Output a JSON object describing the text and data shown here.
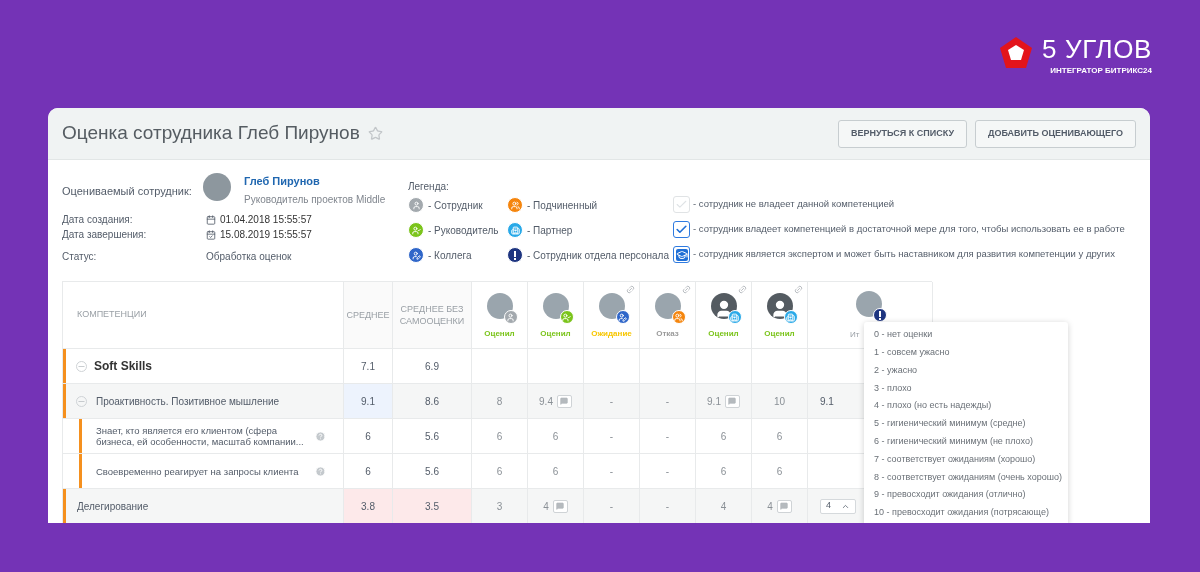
{
  "brand": {
    "name": "5 УГЛОВ",
    "tagline": "ИНТЕГРАТОР БИТРИКС24"
  },
  "header": {
    "title": "Оценка сотрудника Глеб Пирунов",
    "favorite": false,
    "buttons": [
      "ВЕРНУТЬСЯ К СПИСКУ",
      "ДОБАВИТЬ ОЦЕНИВАЮЩЕГО"
    ]
  },
  "info": {
    "employee_label": "Оцениваемый сотрудник:",
    "employee_name": "Глеб Пирунов",
    "employee_position": "Руководитель проектов Middle",
    "created_label": "Дата создания:",
    "created": "01.04.2018 15:55:57",
    "finished_label": "Дата завершения:",
    "finished": "15.08.2019 15:55:57",
    "status_label": "Статус:",
    "status": "Обработка оценок"
  },
  "legend": {
    "title": "Легенда:",
    "roles": [
      {
        "kind": "employee",
        "label": "- Сотрудник"
      },
      {
        "kind": "subordinate",
        "label": "- Подчиненный"
      },
      {
        "kind": "manager",
        "label": "- Руководитель"
      },
      {
        "kind": "partner",
        "label": "- Партнер"
      },
      {
        "kind": "colleague",
        "label": "- Коллега"
      },
      {
        "kind": "hr",
        "label": "- Сотрудник отдела персонала"
      }
    ],
    "levels": [
      {
        "kind": "none",
        "label": "- сотрудник не владеет данной компетенцией"
      },
      {
        "kind": "proficient",
        "label": "- сотрудник владеет компетенцией в достаточной мере для того, чтобы использовать ее в работе"
      },
      {
        "kind": "expert",
        "label": "- сотрудник является экспертом и может быть наставником для развития компетенции у других"
      }
    ]
  },
  "table": {
    "columns": [
      "КОМПЕТЕНЦИИ",
      "СРЕДНЕЕ",
      "СРЕДНЕЕ БЕЗ САМООЦЕНКИ"
    ],
    "evaluators": [
      {
        "kind": "employee",
        "photo": true,
        "link": false,
        "status": "Оценил",
        "color": "#7bc41b"
      },
      {
        "kind": "manager",
        "photo": true,
        "link": false,
        "status": "Оценил",
        "color": "#7bc41b"
      },
      {
        "kind": "colleague",
        "photo": true,
        "link": true,
        "status": "Ожидание",
        "color": "#f7c600"
      },
      {
        "kind": "subordinate",
        "photo": true,
        "link": true,
        "status": "Отказ",
        "color": "#9a9a9a"
      },
      {
        "kind": "partner",
        "photo": false,
        "link": true,
        "status": "Оценил",
        "color": "#7bc41b"
      },
      {
        "kind": "partner",
        "photo": false,
        "link": true,
        "status": "Оценил",
        "color": "#7bc41b"
      }
    ],
    "final_column": {
      "kind": "hr",
      "photo": true,
      "label": "Ит"
    },
    "rows": [
      {
        "kind": "group",
        "name": "Soft Skills",
        "expanded": true,
        "avg": {
          "value": "7.1"
        },
        "avg2": {
          "value": "6.9"
        },
        "scores": []
      },
      {
        "kind": "competence",
        "name": "Проактивность. Позитивное мышление",
        "expanded": true,
        "avg": {
          "value": "9.1",
          "color": "#edf3fd"
        },
        "avg2": {
          "value": "8.6"
        },
        "scores": [
          {
            "value": "8",
            "comment": false
          },
          {
            "value": "9.4",
            "comment": true
          },
          {
            "value": "-",
            "comment": false
          },
          {
            "value": "-",
            "comment": false
          },
          {
            "value": "9.1",
            "comment": true
          },
          {
            "value": "10",
            "comment": false
          }
        ],
        "final": {
          "kind": "value",
          "value": "9.1"
        }
      },
      {
        "kind": "indicator",
        "name": "Знает, кто является его клиентом (сфера бизнеса, ей особенности, масштаб компании...",
        "help": true,
        "avg": {
          "value": "6"
        },
        "avg2": {
          "value": "5.6"
        },
        "scores": [
          {
            "value": "6",
            "comment": false
          },
          {
            "value": "6",
            "comment": false
          },
          {
            "value": "-",
            "comment": false
          },
          {
            "value": "-",
            "comment": false
          },
          {
            "value": "6",
            "comment": false
          },
          {
            "value": "6",
            "comment": false
          }
        ]
      },
      {
        "kind": "indicator",
        "name": "Своевременно реагирует на запросы клиента",
        "help": true,
        "avg": {
          "value": "6"
        },
        "avg2": {
          "value": "5.6"
        },
        "scores": [
          {
            "value": "6",
            "comment": false
          },
          {
            "value": "6",
            "comment": false
          },
          {
            "value": "-",
            "comment": false
          },
          {
            "value": "-",
            "comment": false
          },
          {
            "value": "6",
            "comment": false
          },
          {
            "value": "6",
            "comment": false
          }
        ]
      },
      {
        "kind": "competence",
        "name": "Делегирование",
        "avg": {
          "value": "3.8",
          "color": "#fde9ea"
        },
        "avg2": {
          "value": "3.5",
          "color": "#fde9ea"
        },
        "scores": [
          {
            "value": "3",
            "comment": false
          },
          {
            "value": "4",
            "comment": true
          },
          {
            "value": "-",
            "comment": false
          },
          {
            "value": "-",
            "comment": false
          },
          {
            "value": "4",
            "comment": false
          },
          {
            "value": "4",
            "comment": true
          }
        ],
        "final": {
          "kind": "select",
          "value": "4",
          "open": true
        }
      }
    ]
  },
  "score_menu": {
    "options": [
      "0 - нет оценки",
      "1 - совсем ужасно",
      "2 - ужасно",
      "3 - плохо",
      "4 - плохо (но есть надежды)",
      "5 - гигиенический минимум (средне)",
      "6 - гигиенический минимум (не плохо)",
      "7 - соответствует ожиданиям (хорошо)",
      "8 - соответствует ожиданиям (очень хорошо)",
      "9 - превосходит ожидания (отлично)",
      "10 - превосходит ожидания (потрясающе)"
    ]
  }
}
